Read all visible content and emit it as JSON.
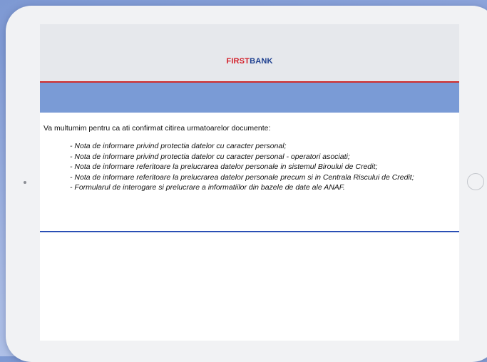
{
  "brand": {
    "first": "FIRST",
    "bank": "BANK"
  },
  "message": {
    "intro": "Va multumim pentru ca ati confirmat citirea urmatoarelor documente:"
  },
  "documents": [
    "- Nota de informare privind protectia datelor cu caracter personal;",
    "- Nota de informare privind protectia datelor cu caracter personal - operatori asociati;",
    "- Nota de informare referitoare la prelucrarea datelor personale in sistemul Biroului de Credit;",
    "- Nota de informare referitoare la prelucrarea datelor personale precum si in Centrala Riscului de Credit;",
    "- Formularul de interogare si prelucrare a informatiilor din bazele de date ale ANAF."
  ],
  "colors": {
    "brand_red": "#d3202a",
    "brand_blue": "#1d3f8f",
    "band_blue": "#7a9bd6",
    "header_gray": "#e6e8ec"
  }
}
